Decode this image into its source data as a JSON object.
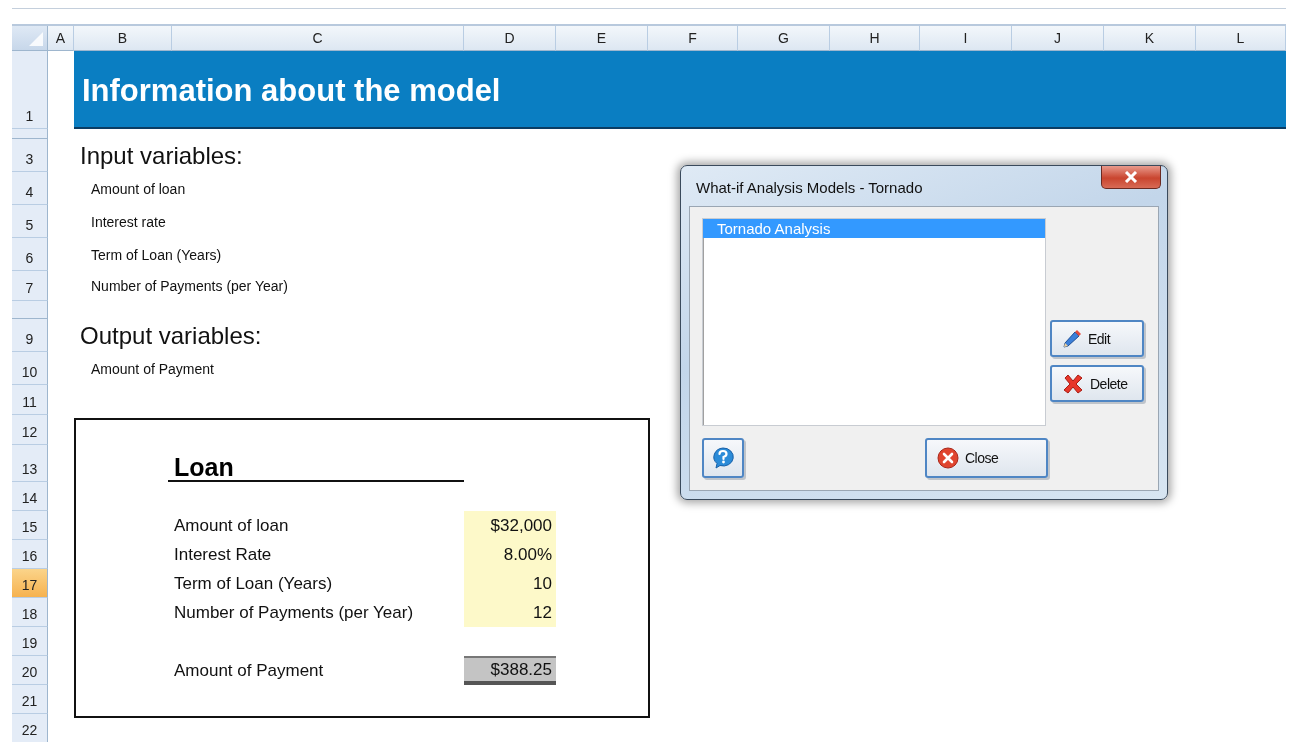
{
  "sheet": {
    "columns": [
      "A",
      "B",
      "C",
      "D",
      "E",
      "F",
      "G",
      "H",
      "I",
      "J",
      "K",
      "L"
    ],
    "rows": [
      {
        "number": "1",
        "selected": false
      },
      {
        "number": "3",
        "selected": false
      },
      {
        "number": "4",
        "selected": false
      },
      {
        "number": "5",
        "selected": false
      },
      {
        "number": "6",
        "selected": false
      },
      {
        "number": "7",
        "selected": false
      },
      {
        "number": "9",
        "selected": false
      },
      {
        "number": "10",
        "selected": false
      },
      {
        "number": "11",
        "selected": false
      },
      {
        "number": "12",
        "selected": false
      },
      {
        "number": "13",
        "selected": false
      },
      {
        "number": "14",
        "selected": false
      },
      {
        "number": "15",
        "selected": false
      },
      {
        "number": "16",
        "selected": false
      },
      {
        "number": "17",
        "selected": true
      },
      {
        "number": "18",
        "selected": false
      },
      {
        "number": "19",
        "selected": false
      },
      {
        "number": "20",
        "selected": false
      },
      {
        "number": "21",
        "selected": false
      },
      {
        "number": "22",
        "selected": false
      }
    ]
  },
  "banner": "Information about the model",
  "input_heading": "Input variables:",
  "inputs": [
    "Amount of loan",
    "Interest rate",
    "Term of Loan (Years)",
    "Number of Payments (per Year)"
  ],
  "output_heading": "Output variables:",
  "outputs": [
    "Amount of Payment"
  ],
  "loan": {
    "title": "Loan",
    "inputs": [
      {
        "label": "Amount of loan",
        "value": "$32,000"
      },
      {
        "label": "Interest Rate",
        "value": "8.00%"
      },
      {
        "label": "Term of Loan (Years)",
        "value": "10"
      },
      {
        "label": "Number of Payments (per Year)",
        "value": "12"
      }
    ],
    "output": {
      "label": "Amount of Payment",
      "value": "$388.25"
    }
  },
  "dialog": {
    "title": "What-if Analysis Models - Tornado",
    "items": [
      {
        "label": "Tornado Analysis",
        "selected": true
      }
    ],
    "buttons": [
      {
        "kind": "edit",
        "label": "Edit"
      },
      {
        "kind": "delete",
        "label": "Delete"
      },
      {
        "kind": "help"
      },
      {
        "kind": "close",
        "label": "Close"
      }
    ]
  }
}
